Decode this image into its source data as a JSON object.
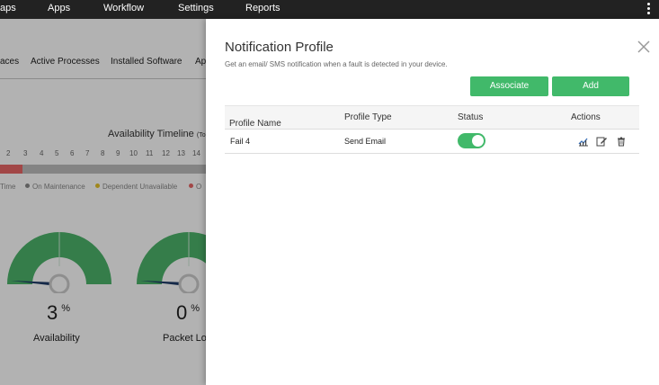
{
  "topnav": {
    "items": [
      "aps",
      "Apps",
      "Workflow",
      "Settings",
      "Reports"
    ]
  },
  "background": {
    "subtabs": [
      "aces",
      "Active Processes",
      "Installed Software",
      "Ap"
    ],
    "timeline": {
      "title": "Availability Timeline",
      "title_suffix": "(To",
      "hours": [
        "2",
        "3",
        "4",
        "5",
        "6",
        "7",
        "8",
        "9",
        "10",
        "11",
        "12",
        "13",
        "14"
      ],
      "legend": [
        {
          "label": "Time",
          "color": ""
        },
        {
          "label": "On Maintenance",
          "color": "#888888"
        },
        {
          "label": "Dependent Unavailable",
          "color": "#e6c229"
        },
        {
          "label": "O",
          "color": "#e86666"
        }
      ]
    },
    "gauges": [
      {
        "value": "3",
        "unit": "%",
        "label": "Availability"
      },
      {
        "value": "0",
        "unit": "%",
        "label": "Packet Lo"
      }
    ]
  },
  "panel": {
    "title": "Notification Profile",
    "subtitle": "Get an email/ SMS notification when a fault is detected in your device.",
    "buttons": {
      "associate": "Associate",
      "add": "Add"
    },
    "table": {
      "headers": {
        "profile_name": "Profile Name",
        "sort_icon": "↑",
        "profile_type": "Profile Type",
        "status": "Status",
        "actions": "Actions"
      },
      "rows": [
        {
          "profile_name": "Fail 4",
          "profile_type": "Send Email",
          "status_enabled": true
        }
      ]
    }
  },
  "colors": {
    "accent_green": "#41b96a",
    "nav_bg": "#222222",
    "outage_red": "#e86666"
  }
}
